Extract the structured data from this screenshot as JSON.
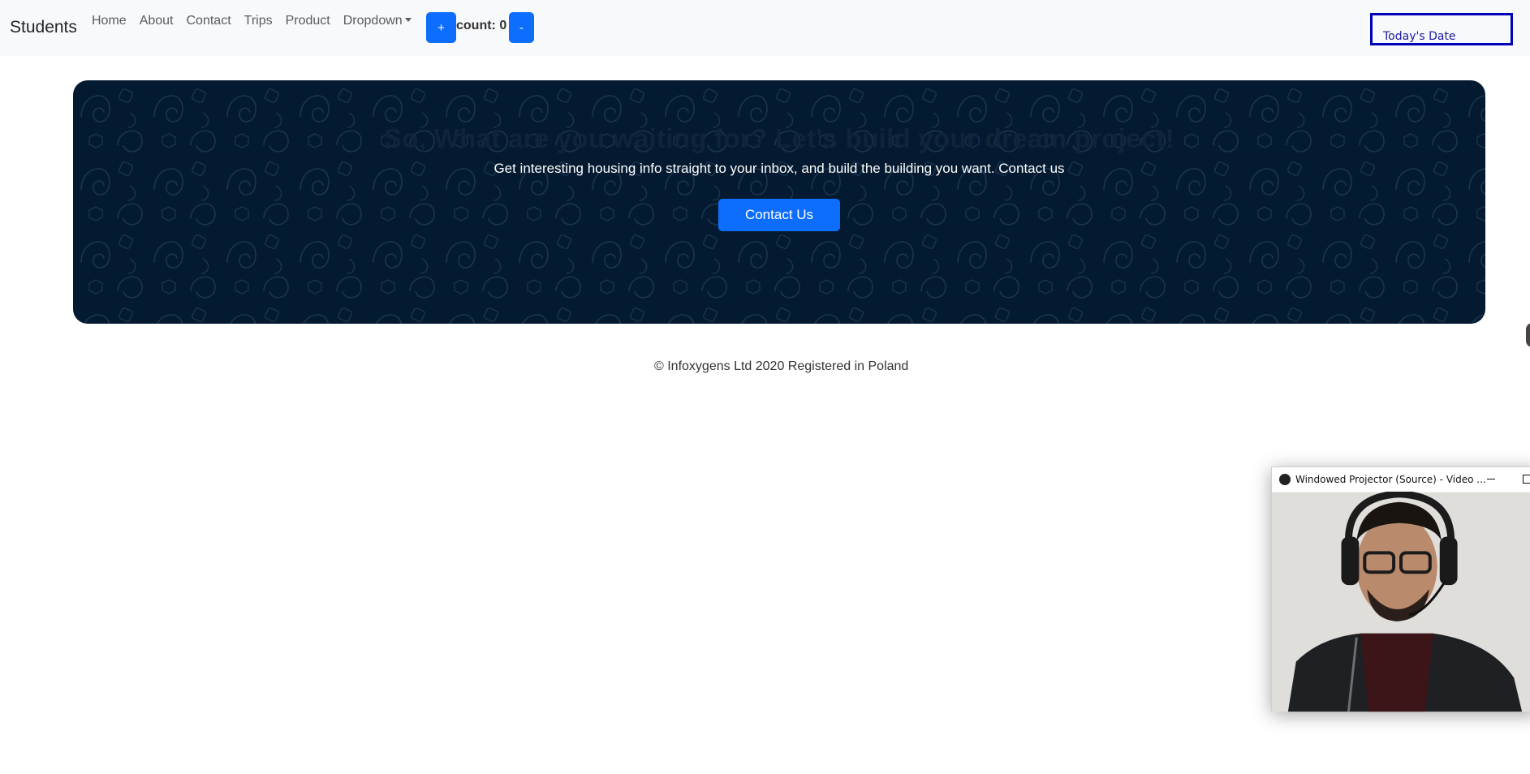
{
  "navbar": {
    "brand": "Students",
    "links": [
      "Home",
      "About",
      "Contact",
      "Trips",
      "Product",
      "Dropdown"
    ],
    "counter": {
      "plus_label": "+",
      "count_text": "count: 0",
      "minus_label": "-"
    },
    "date_label": "Today's Date"
  },
  "hero": {
    "title": "So, What are you waiting for? Let's build your dream project!",
    "subtitle": "Get interesting housing info straight to your inbox, and build the building you want. Contact us",
    "button_label": "Contact Us"
  },
  "footer": {
    "text": "© Infoxygens Ltd 2020 Registered in Poland"
  },
  "projector": {
    "title": "Windowed Projector (Source) - Video ..."
  },
  "colors": {
    "primary": "#0d6efd",
    "hero_bg": "#041a30",
    "navbar_bg": "#f8f9fa",
    "date_border": "#0000b8"
  }
}
